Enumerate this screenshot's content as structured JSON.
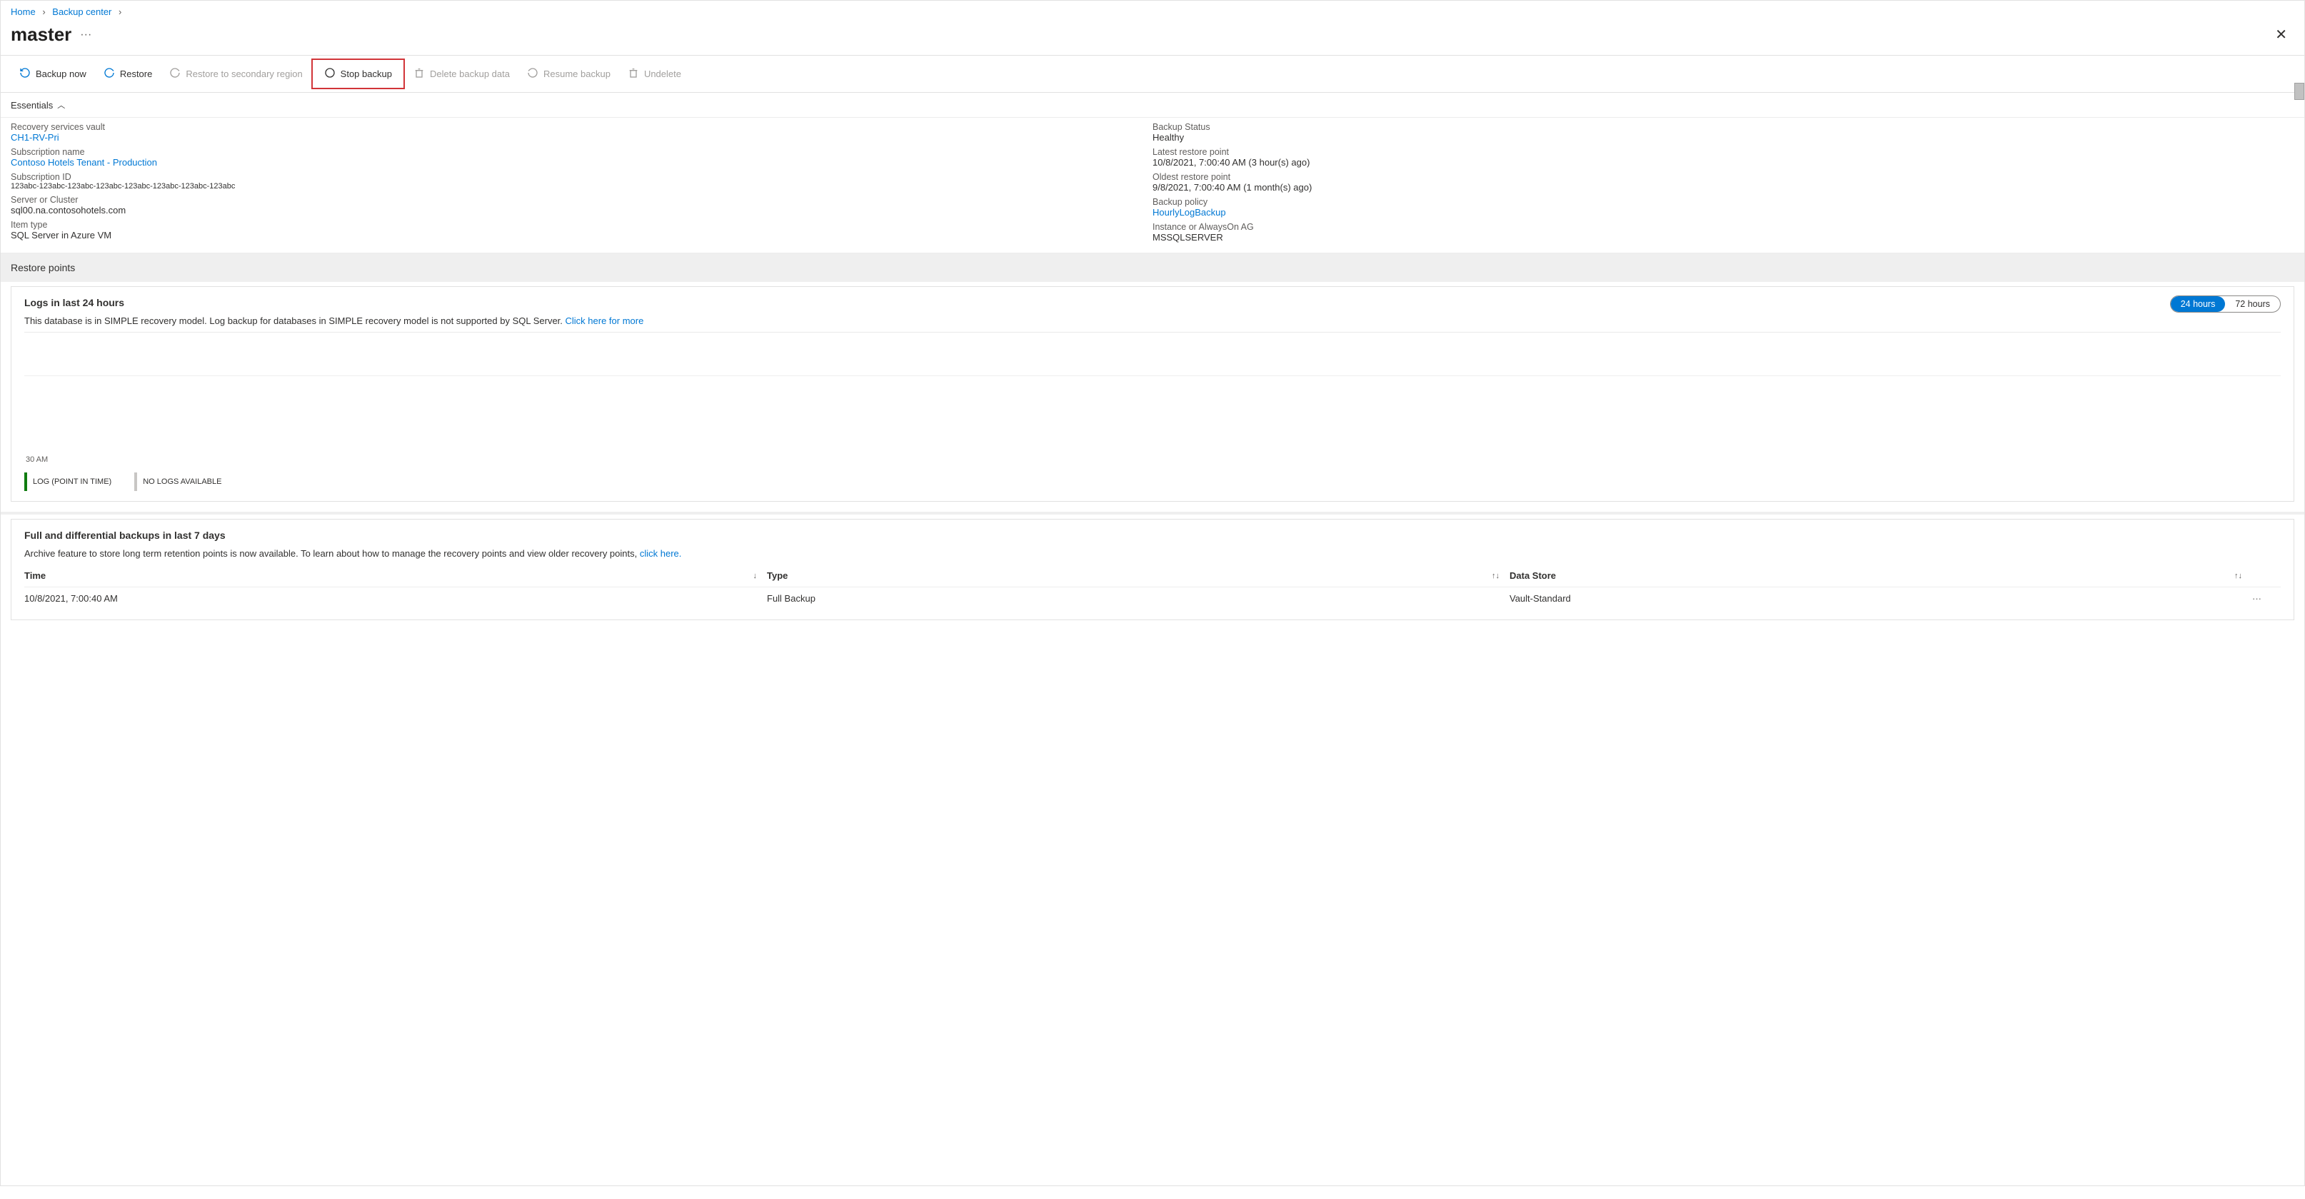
{
  "breadcrumb": {
    "home": "Home",
    "backup_center": "Backup center"
  },
  "page_title": "master",
  "toolbar": {
    "backup_now": "Backup now",
    "restore": "Restore",
    "restore_secondary": "Restore to secondary region",
    "stop_backup": "Stop backup",
    "delete_data": "Delete backup data",
    "resume_backup": "Resume backup",
    "undelete": "Undelete"
  },
  "essentials_label": "Essentials",
  "essentials": {
    "left": {
      "vault_label": "Recovery services vault",
      "vault_value": "CH1-RV-Pri",
      "sub_name_label": "Subscription name",
      "sub_name_value": "Contoso Hotels Tenant - Production",
      "sub_id_label": "Subscription ID",
      "sub_id_value": "123abc-123abc-123abc-123abc-123abc-123abc-123abc-123abc",
      "server_label": "Server or Cluster",
      "server_value": "sql00.na.contosohotels.com",
      "item_type_label": "Item type",
      "item_type_value": "SQL Server in Azure VM"
    },
    "right": {
      "status_label": "Backup Status",
      "status_value": "Healthy",
      "latest_label": "Latest restore point",
      "latest_value": "10/8/2021, 7:00:40 AM (3 hour(s) ago)",
      "oldest_label": "Oldest restore point",
      "oldest_value": "9/8/2021, 7:00:40 AM (1 month(s) ago)",
      "policy_label": "Backup policy",
      "policy_value": "HourlyLogBackup",
      "instance_label": "Instance or AlwaysOn AG",
      "instance_value": "MSSQLSERVER"
    }
  },
  "restore_points": {
    "heading": "Restore points",
    "logs_title": "Logs in last 24 hours",
    "logs_info": "This database is in SIMPLE recovery model. Log backup for databases in SIMPLE recovery model is not supported by SQL Server. ",
    "logs_link": "Click here for more",
    "range_24": "24 hours",
    "range_72": "72 hours",
    "axis_label": "30 AM",
    "legend_log": "LOG (POINT IN TIME)",
    "legend_none": "NO LOGS AVAILABLE",
    "full_title": "Full and differential backups in last 7 days",
    "full_info": "Archive feature to store long term retention points is now available. To learn about how to manage the recovery points and view older recovery points, ",
    "full_link": "click here.",
    "columns": {
      "time": "Time",
      "type": "Type",
      "datastore": "Data Store"
    },
    "rows": [
      {
        "time": "10/8/2021, 7:00:40 AM",
        "type": "Full Backup",
        "datastore": "Vault-Standard"
      }
    ]
  }
}
